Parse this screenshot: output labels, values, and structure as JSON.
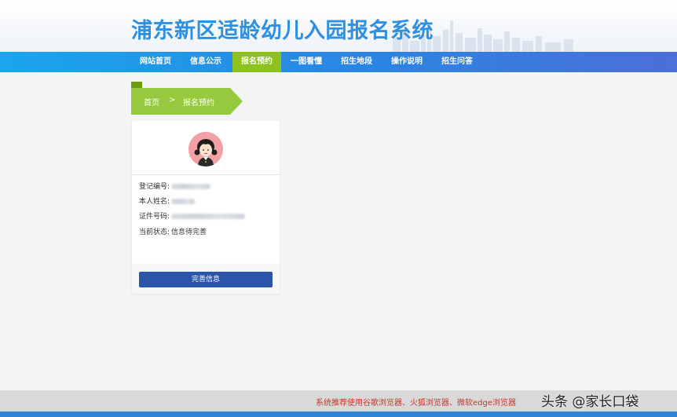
{
  "header": {
    "title": "浦东新区适龄幼儿入园报名系统"
  },
  "nav": {
    "items": [
      {
        "label": "网站首页"
      },
      {
        "label": "信息公示"
      },
      {
        "label": "报名预约",
        "active": true
      },
      {
        "label": "一图看懂"
      },
      {
        "label": "招生地段"
      },
      {
        "label": "操作说明"
      },
      {
        "label": "招生问答"
      }
    ]
  },
  "breadcrumb": {
    "home": "首页",
    "separator": ">",
    "current": "报名预约"
  },
  "profile": {
    "registration_label": "登记编号:",
    "name_label": "本人姓名:",
    "id_label": "证件号码:",
    "status_label": "当前状态:",
    "status_value": "信息待完善"
  },
  "actions": {
    "complete_label": "完善信息"
  },
  "footer": {
    "notice": "系统推荐使用谷歌浏览器、火狐浏览器、微软edge浏览器",
    "watermark": "头条 @家长口袋"
  },
  "colors": {
    "nav_start": "#1aa6ec",
    "nav_end": "#4c6fd8",
    "active_green": "#8dc21f",
    "button_blue": "#2a55a8",
    "title_blue": "#2f8fe0",
    "notice_red": "#c0392b"
  }
}
